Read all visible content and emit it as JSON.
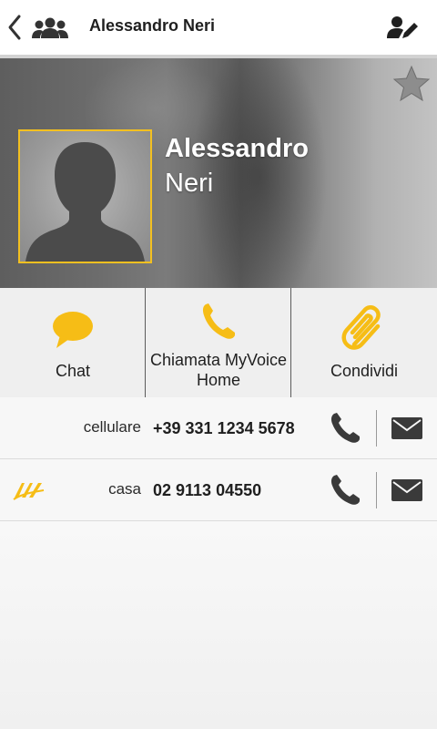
{
  "topbar": {
    "title": "Alessandro Neri",
    "back_icon": "chevron-left-icon",
    "contacts_icon": "group-icon",
    "edit_icon": "edit-contact-icon"
  },
  "contact": {
    "first_name": "Alessandro",
    "last_name": "Neri",
    "favorite": false,
    "accent_color": "#f3c020"
  },
  "actions": [
    {
      "label": "Chat",
      "icon": "chat-bubble-icon"
    },
    {
      "label_line1": "Chiamata MyVoice",
      "label_line2": "Home",
      "icon": "phone-icon"
    },
    {
      "label": "Condividi",
      "icon": "paperclip-icon"
    }
  ],
  "phones": [
    {
      "type": "cellulare",
      "number": "+39 331 1234 5678",
      "call_icon": "phone-icon",
      "message_icon": "envelope-icon"
    },
    {
      "type": "casa",
      "number": "02 9113 04550",
      "brand_icon": "myvoice-logo-icon",
      "call_icon": "phone-icon",
      "message_icon": "envelope-icon"
    }
  ]
}
